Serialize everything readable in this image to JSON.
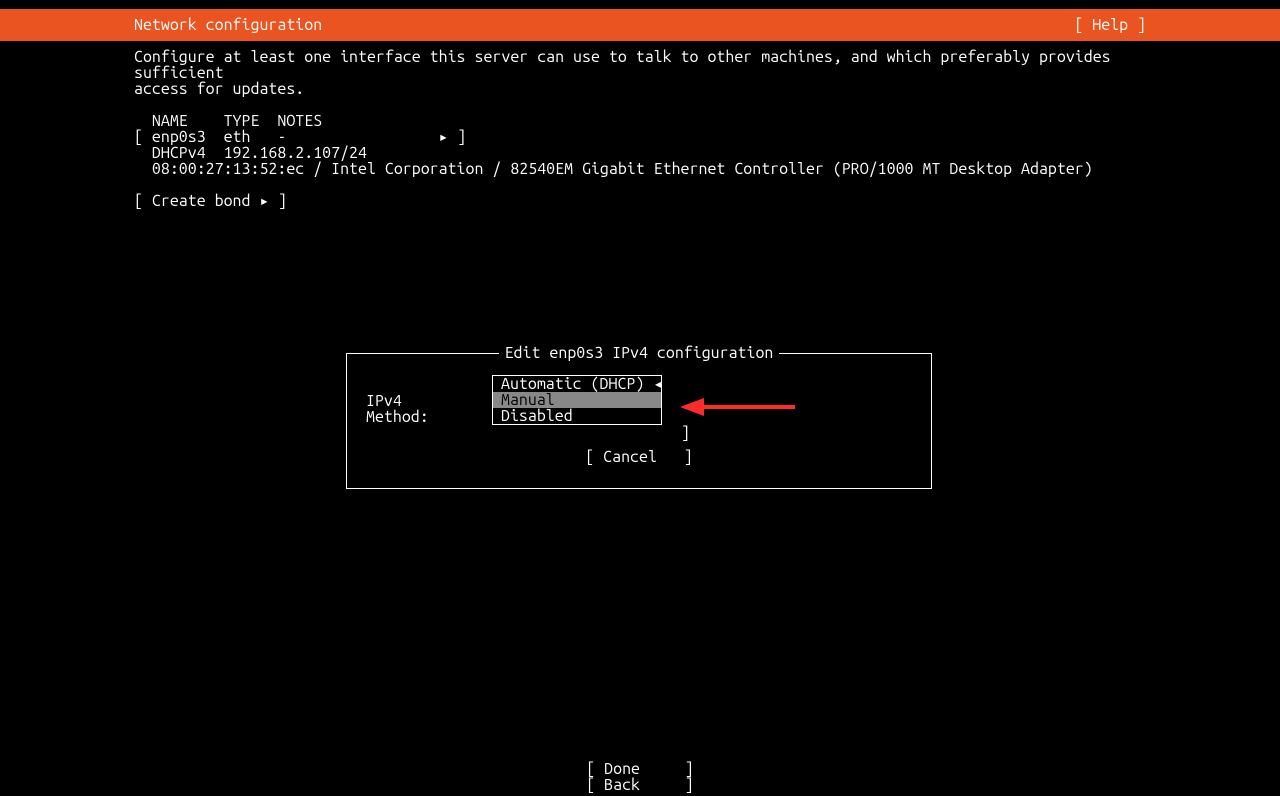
{
  "header": {
    "title": "Network configuration",
    "help": "[ Help ]"
  },
  "intro": "Configure at least one interface this server can use to talk to other machines, and which preferably provides sufficient\naccess for updates.",
  "table": {
    "headers_line": "  NAME    TYPE  NOTES",
    "iface_line": "[ enp0s3  eth   -                 ▸ ]",
    "ip_line": "  DHCPv4  192.168.2.107/24",
    "hw_line": "  08:00:27:13:52:ec / Intel Corporation / 82540EM Gigabit Ethernet Controller (PRO/1000 MT Desktop Adapter)"
  },
  "create_bond": "[ Create bond ▸ ]",
  "dialog": {
    "title": "Edit enp0s3 IPv4 configuration",
    "method_label": "IPv4 Method:",
    "options": {
      "auto": "Automatic (DHCP) ◂",
      "manual": "Manual",
      "disabled": "Disabled"
    },
    "right_bracket": "]",
    "cancel": "[ Cancel   ]"
  },
  "footer": {
    "done": "[ Done     ]",
    "back": "[ Back     ]"
  }
}
